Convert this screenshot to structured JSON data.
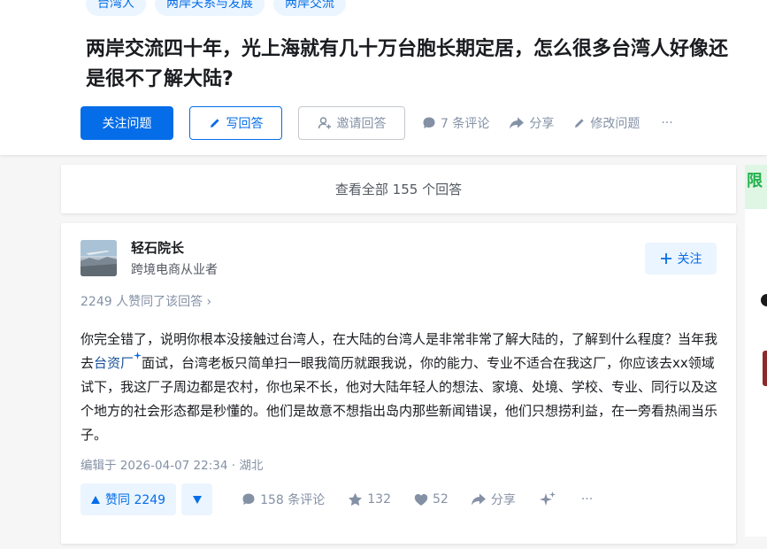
{
  "question": {
    "topics": [
      "台湾人",
      "两岸关系与发展",
      "两岸交流"
    ],
    "title": "两岸交流四十年，光上海就有几十万台胞长期定居，怎么很多台湾人好像还是很不了解大陆?",
    "follow_label": "关注问题",
    "write_answer_label": "写回答",
    "invite_label": "邀请回答",
    "comments_label": "7 条评论",
    "share_label": "分享",
    "edit_label": "修改问题",
    "more_label": "···"
  },
  "view_all_label": "查看全部 155 个回答",
  "answer": {
    "author_name": "轻石院长",
    "author_bio": "跨境电商从业者",
    "follow_label": "关注",
    "vote_summary": "2249 人赞同了该回答 ›",
    "content_parts": {
      "before": "你完全错了，说明你根本没接触过台湾人，在大陆的台湾人是非常非常了解大陆的，了解到什么程度？当年我去",
      "keyword": "台资厂",
      "after": "面试，台湾老板只简单扫一眼我简历就跟我说，你的能力、专业不适合在我这厂，你应该去xx领域试下，我这厂子周边都是农村，你也呆不长，他对大陆年轻人的想法、家境、处境、学校、专业、同行以及这个地方的社会形态都是秒懂的。他们是故意不想指出岛内那些新闻错误，他们只想捞利益，在一旁看热闹当乐子。"
    },
    "edited": "编辑于 2026-04-07 22:34 · 湖北",
    "vote_up_label": "赞同 2249",
    "comments_label": "158 条评论",
    "favorites": "132",
    "likes": "52",
    "share_label": "分享",
    "more_label": "···"
  },
  "sidebar": {
    "banner_text": "限"
  },
  "colors": {
    "brand_blue": "#056de8",
    "light_blue": "#ebf5ff",
    "gray_text": "#8491a5"
  }
}
